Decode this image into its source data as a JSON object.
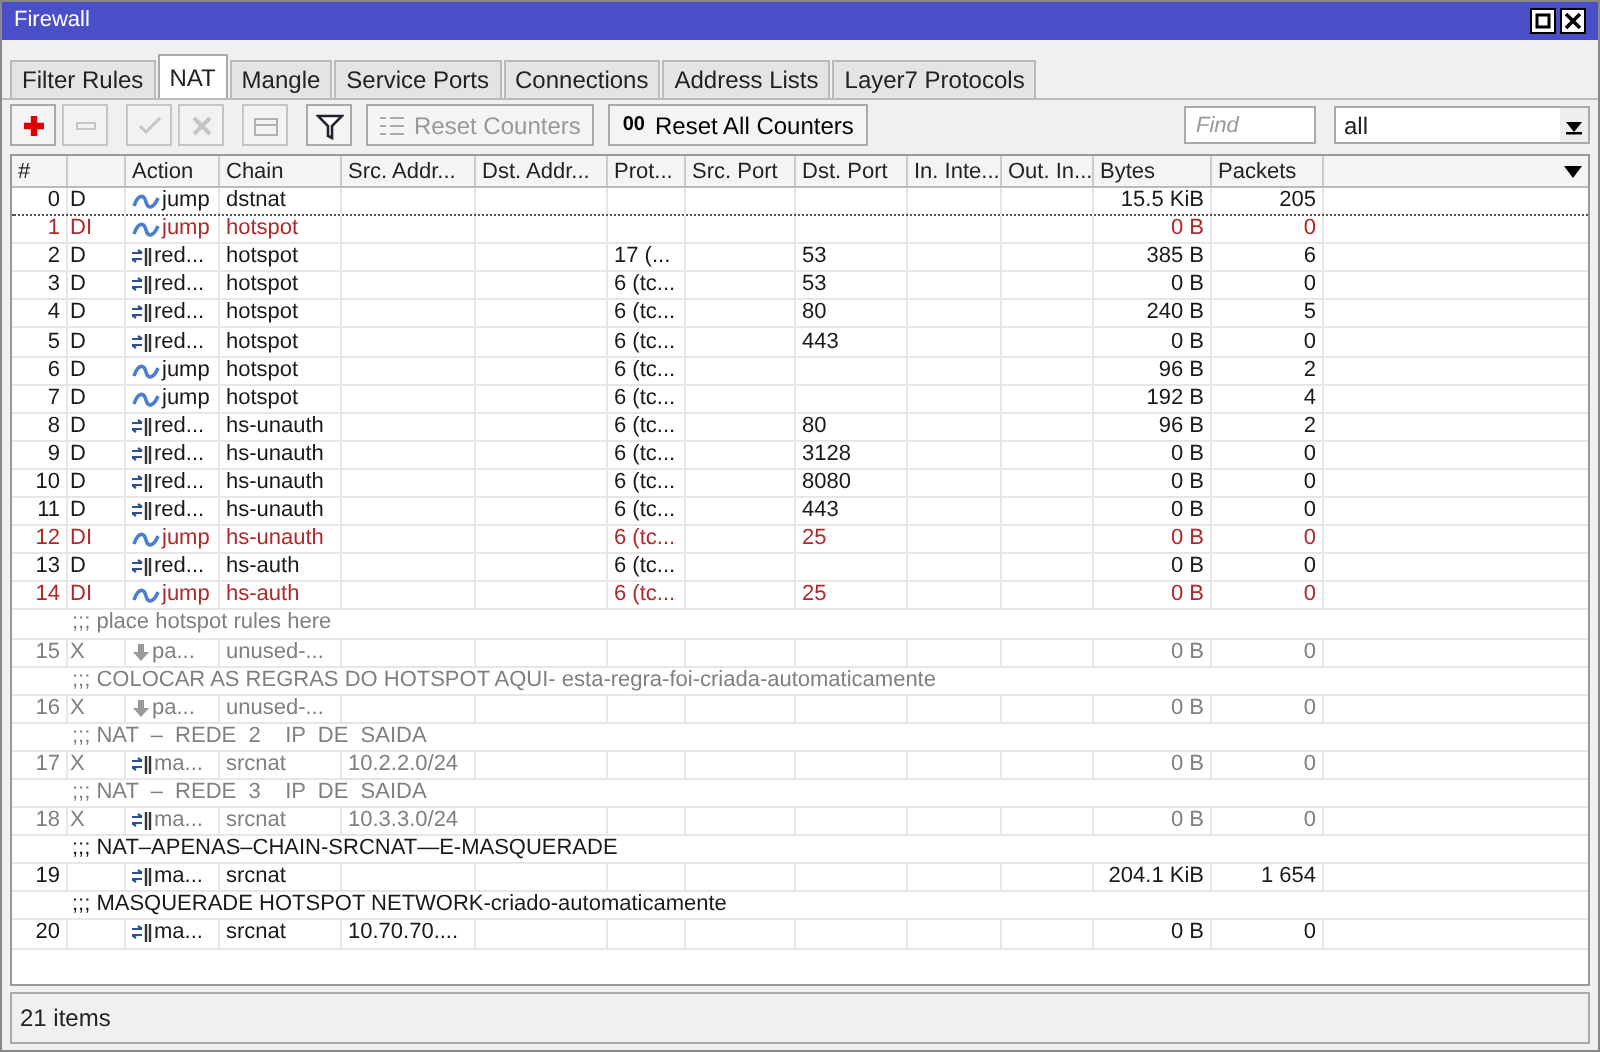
{
  "window": {
    "title": "Firewall"
  },
  "tabs": [
    {
      "label": "Filter Rules",
      "selected": false
    },
    {
      "label": "NAT",
      "selected": true
    },
    {
      "label": "Mangle",
      "selected": false
    },
    {
      "label": "Service Ports",
      "selected": false
    },
    {
      "label": "Connections",
      "selected": false
    },
    {
      "label": "Address Lists",
      "selected": false
    },
    {
      "label": "Layer7 Protocols",
      "selected": false
    }
  ],
  "toolbar": {
    "buttons": [
      {
        "kind": "add",
        "disabled": false
      },
      {
        "kind": "remove",
        "disabled": true
      },
      {
        "kind": "enable",
        "disabled": true
      },
      {
        "kind": "disable",
        "disabled": true
      },
      {
        "kind": "comment",
        "disabled": true
      },
      {
        "kind": "filter",
        "disabled": false
      }
    ],
    "text_buttons": [
      {
        "kind": "reset",
        "label": "Reset Counters",
        "disabled": true
      },
      {
        "kind": "reset_all",
        "icon_text": "00",
        "label": "Reset All Counters",
        "disabled": false
      }
    ],
    "find": {
      "placeholder": "Find"
    },
    "filter_select": {
      "value": "all"
    }
  },
  "table": {
    "columns": [
      "#",
      "",
      "Action",
      "Chain",
      "Src. Addr...",
      "Dst. Addr...",
      "Prot...",
      "Src. Port",
      "Dst. Port",
      "In. Inte...",
      "Out. In...",
      "Bytes",
      "Packets"
    ],
    "rows": [
      {
        "kind": "rule",
        "num": "0",
        "flags": "D",
        "icon": {
          "kind": "jump"
        },
        "action": "jump",
        "chain": "dstnat",
        "bytes": "15.5 KiB",
        "packets": "205",
        "invalid": false,
        "disabled": false,
        "focused": true
      },
      {
        "kind": "rule",
        "num": "1",
        "flags": "DI",
        "icon": {
          "kind": "jump"
        },
        "action": "jump",
        "chain": "hotspot",
        "bytes": "0 B",
        "packets": "0",
        "invalid": true,
        "disabled": false,
        "focused": false
      },
      {
        "kind": "rule",
        "num": "2",
        "flags": "D",
        "icon": {
          "kind": "redirect"
        },
        "action": "red...",
        "chain": "hotspot",
        "proto": "17 (...",
        "dst_port": "53",
        "bytes": "385 B",
        "packets": "6",
        "invalid": false,
        "disabled": false,
        "focused": false
      },
      {
        "kind": "rule",
        "num": "3",
        "flags": "D",
        "icon": {
          "kind": "redirect"
        },
        "action": "red...",
        "chain": "hotspot",
        "proto": "6 (tc...",
        "dst_port": "53",
        "bytes": "0 B",
        "packets": "0",
        "invalid": false,
        "disabled": false,
        "focused": false
      },
      {
        "kind": "rule",
        "num": "4",
        "flags": "D",
        "icon": {
          "kind": "redirect"
        },
        "action": "red...",
        "chain": "hotspot",
        "proto": "6 (tc...",
        "dst_port": "80",
        "bytes": "240 B",
        "packets": "5",
        "invalid": false,
        "disabled": false,
        "focused": false
      },
      {
        "kind": "rule",
        "num": "5",
        "flags": "D",
        "icon": {
          "kind": "redirect"
        },
        "action": "red...",
        "chain": "hotspot",
        "proto": "6 (tc...",
        "dst_port": "443",
        "bytes": "0 B",
        "packets": "0",
        "invalid": false,
        "disabled": false,
        "focused": false
      },
      {
        "kind": "rule",
        "num": "6",
        "flags": "D",
        "icon": {
          "kind": "jump"
        },
        "action": "jump",
        "chain": "hotspot",
        "proto": "6 (tc...",
        "bytes": "96 B",
        "packets": "2",
        "invalid": false,
        "disabled": false,
        "focused": false
      },
      {
        "kind": "rule",
        "num": "7",
        "flags": "D",
        "icon": {
          "kind": "jump"
        },
        "action": "jump",
        "chain": "hotspot",
        "proto": "6 (tc...",
        "bytes": "192 B",
        "packets": "4",
        "invalid": false,
        "disabled": false,
        "focused": false
      },
      {
        "kind": "rule",
        "num": "8",
        "flags": "D",
        "icon": {
          "kind": "redirect"
        },
        "action": "red...",
        "chain": "hs-unauth",
        "proto": "6 (tc...",
        "dst_port": "80",
        "bytes": "96 B",
        "packets": "2",
        "invalid": false,
        "disabled": false,
        "focused": false
      },
      {
        "kind": "rule",
        "num": "9",
        "flags": "D",
        "icon": {
          "kind": "redirect"
        },
        "action": "red...",
        "chain": "hs-unauth",
        "proto": "6 (tc...",
        "dst_port": "3128",
        "bytes": "0 B",
        "packets": "0",
        "invalid": false,
        "disabled": false,
        "focused": false
      },
      {
        "kind": "rule",
        "num": "10",
        "flags": "D",
        "icon": {
          "kind": "redirect"
        },
        "action": "red...",
        "chain": "hs-unauth",
        "proto": "6 (tc...",
        "dst_port": "8080",
        "bytes": "0 B",
        "packets": "0",
        "invalid": false,
        "disabled": false,
        "focused": false
      },
      {
        "kind": "rule",
        "num": "11",
        "flags": "D",
        "icon": {
          "kind": "redirect"
        },
        "action": "red...",
        "chain": "hs-unauth",
        "proto": "6 (tc...",
        "dst_port": "443",
        "bytes": "0 B",
        "packets": "0",
        "invalid": false,
        "disabled": false,
        "focused": false
      },
      {
        "kind": "rule",
        "num": "12",
        "flags": "DI",
        "icon": {
          "kind": "jump"
        },
        "action": "jump",
        "chain": "hs-unauth",
        "proto": "6 (tc...",
        "dst_port": "25",
        "bytes": "0 B",
        "packets": "0",
        "invalid": true,
        "disabled": false,
        "focused": false
      },
      {
        "kind": "rule",
        "num": "13",
        "flags": "D",
        "icon": {
          "kind": "redirect"
        },
        "action": "red...",
        "chain": "hs-auth",
        "proto": "6 (tc...",
        "bytes": "0 B",
        "packets": "0",
        "invalid": false,
        "disabled": false,
        "focused": false
      },
      {
        "kind": "rule",
        "num": "14",
        "flags": "DI",
        "icon": {
          "kind": "jump"
        },
        "action": "jump",
        "chain": "hs-auth",
        "proto": "6 (tc...",
        "dst_port": "25",
        "bytes": "0 B",
        "packets": "0",
        "invalid": true,
        "disabled": false,
        "focused": false
      },
      {
        "kind": "comment",
        "text": ";;; place hotspot rules here",
        "disabled": true
      },
      {
        "kind": "rule",
        "num": "15",
        "flags": "X",
        "icon": {
          "kind": "passthrough"
        },
        "action": "pa...",
        "chain": "unused-...",
        "bytes": "0 B",
        "packets": "0",
        "invalid": false,
        "disabled": true,
        "focused": false
      },
      {
        "kind": "comment",
        "text": ";;; COLOCAR AS REGRAS DO HOTSPOT AQUI- esta-regra-foi-criada-automaticamente",
        "disabled": true
      },
      {
        "kind": "rule",
        "num": "16",
        "flags": "X",
        "icon": {
          "kind": "passthrough"
        },
        "action": "pa...",
        "chain": "unused-...",
        "bytes": "0 B",
        "packets": "0",
        "invalid": false,
        "disabled": true,
        "focused": false
      },
      {
        "kind": "comment",
        "text": ";;; NAT  –  REDE  2    IP  DE  SAIDA",
        "disabled": true
      },
      {
        "kind": "rule",
        "num": "17",
        "flags": "X",
        "icon": {
          "kind": "redirect"
        },
        "action": "ma...",
        "chain": "srcnat",
        "src": "10.2.2.0/24",
        "bytes": "0 B",
        "packets": "0",
        "invalid": false,
        "disabled": true,
        "focused": false
      },
      {
        "kind": "comment",
        "text": ";;; NAT  –  REDE  3    IP  DE  SAIDA",
        "disabled": true
      },
      {
        "kind": "rule",
        "num": "18",
        "flags": "X",
        "icon": {
          "kind": "redirect"
        },
        "action": "ma...",
        "chain": "srcnat",
        "src": "10.3.3.0/24",
        "bytes": "0 B",
        "packets": "0",
        "invalid": false,
        "disabled": true,
        "focused": false
      },
      {
        "kind": "comment",
        "text": ";;; NAT–APENAS–CHAIN-SRCNAT—E-MASQUERADE",
        "disabled": false
      },
      {
        "kind": "rule",
        "num": "19",
        "icon": {
          "kind": "redirect"
        },
        "action": "ma...",
        "chain": "srcnat",
        "bytes": "204.1 KiB",
        "packets": "1 654",
        "invalid": false,
        "disabled": false,
        "focused": false
      },
      {
        "kind": "comment",
        "text": ";;; MASQUERADE HOTSPOT NETWORK-criado-automaticamente",
        "disabled": false
      },
      {
        "kind": "rule",
        "num": "20",
        "icon": {
          "kind": "redirect"
        },
        "action": "ma...",
        "chain": "srcnat",
        "src": "10.70.70....",
        "bytes": "0 B",
        "packets": "0",
        "invalid": false,
        "disabled": false,
        "focused": false
      }
    ]
  },
  "status_bar": {
    "text": "21 items"
  }
}
